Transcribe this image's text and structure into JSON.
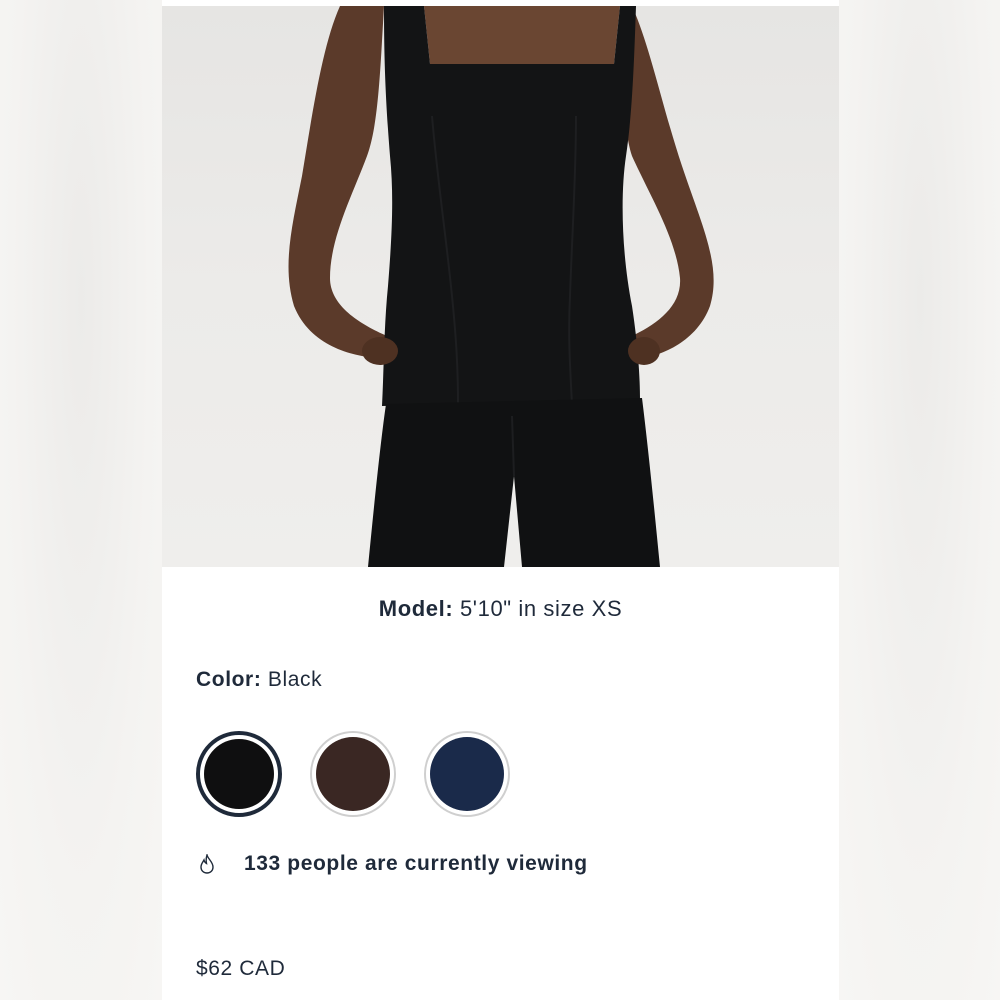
{
  "product": {
    "image_alt": "Model wearing black square-neck sleeveless top and black pants",
    "model_label": "Model:",
    "model_value": "5'10\" in size XS",
    "color_label": "Color:",
    "color_value": "Black",
    "swatches": [
      {
        "name": "Black",
        "hex": "#0f0f10",
        "selected": true
      },
      {
        "name": "Brown",
        "hex": "#3a2723",
        "selected": false
      },
      {
        "name": "Navy",
        "hex": "#1a2a4a",
        "selected": false
      }
    ],
    "viewing_text": "133 people are currently viewing",
    "price": "$62 CAD"
  },
  "colors": {
    "text": "#1f2a3a",
    "selected_ring": "#1f2a3a"
  }
}
